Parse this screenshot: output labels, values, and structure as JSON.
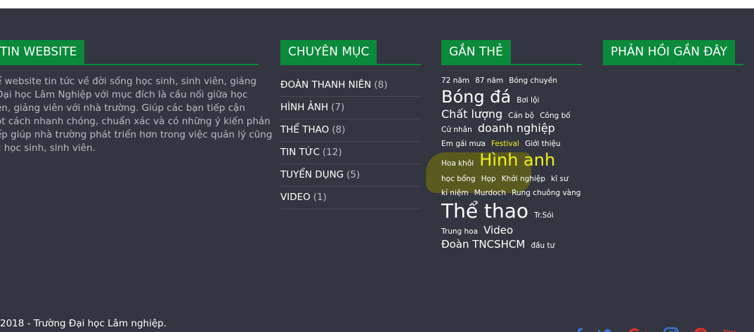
{
  "about": {
    "title": "TIN WEBSITE",
    "lines": [
      "ể website tin tức về đời sống học sinh, sinh viên, giảng",
      "Đại học Lâm Nghiệp với mục đích là cầu nối giữa học",
      "ên, giảng viên với nhà trường. Giúp các bạn tiếp cận",
      "ột cách nhanh chóng, chuẩn xác và có những ý kiến phản",
      "ếp giúp nhà trường phát triển hơn trong việc quản lý cũng",
      "c học sinh, sinh viên."
    ]
  },
  "categories": {
    "title": "CHUYÊN MỤC",
    "items": [
      {
        "name": "ĐOÀN THANH NIÊN",
        "count": "(8)"
      },
      {
        "name": "HÌNH ẢNH",
        "count": "(7)"
      },
      {
        "name": "THỂ THAO",
        "count": "(8)"
      },
      {
        "name": "TIN TỨC",
        "count": "(12)"
      },
      {
        "name": "TUYỂN DỤNG",
        "count": "(5)"
      },
      {
        "name": "VIDEO",
        "count": "(1)"
      }
    ]
  },
  "tags": {
    "title": "GẮN THẺ",
    "items": [
      "72 năm",
      "87 năm",
      "Bóng chuyền",
      "Bóng đá",
      "Bơi lội",
      "Chất lượng",
      "Cán bộ",
      "Công bố",
      "Cử nhân",
      "doanh nghiệp",
      "Em gái mưa",
      "Festival",
      "Giới thiệu",
      "Hoa khôi",
      "Hình anh",
      "học bổng",
      "Họp",
      "Khởi nghiệp",
      "kĩ sư",
      "kỉ niệm",
      "Murdoch",
      "Rung chuông vàng",
      "Thể thao",
      "Tr.Sói",
      "Trung hoa",
      "Video",
      "Đoàn TNCSHCM",
      "đầu tư"
    ]
  },
  "feedback": {
    "title": "PHẢN HỒI GẦN ĐÂY"
  },
  "copyright": "2018 - Trường Đại học Lâm nghiệp.",
  "social_icons": [
    "facebook-icon",
    "twitter-icon",
    "google-plus-icon",
    "instagram-icon",
    "pinterest-icon",
    "youtube-icon"
  ],
  "colors": {
    "footer_bg": "#333640",
    "accent": "#0a8a3a",
    "text_muted": "#b9bcc3",
    "tag_highlight": "#f1f017",
    "social_red": "#e0332c",
    "social_blue": "#3b76d6"
  }
}
